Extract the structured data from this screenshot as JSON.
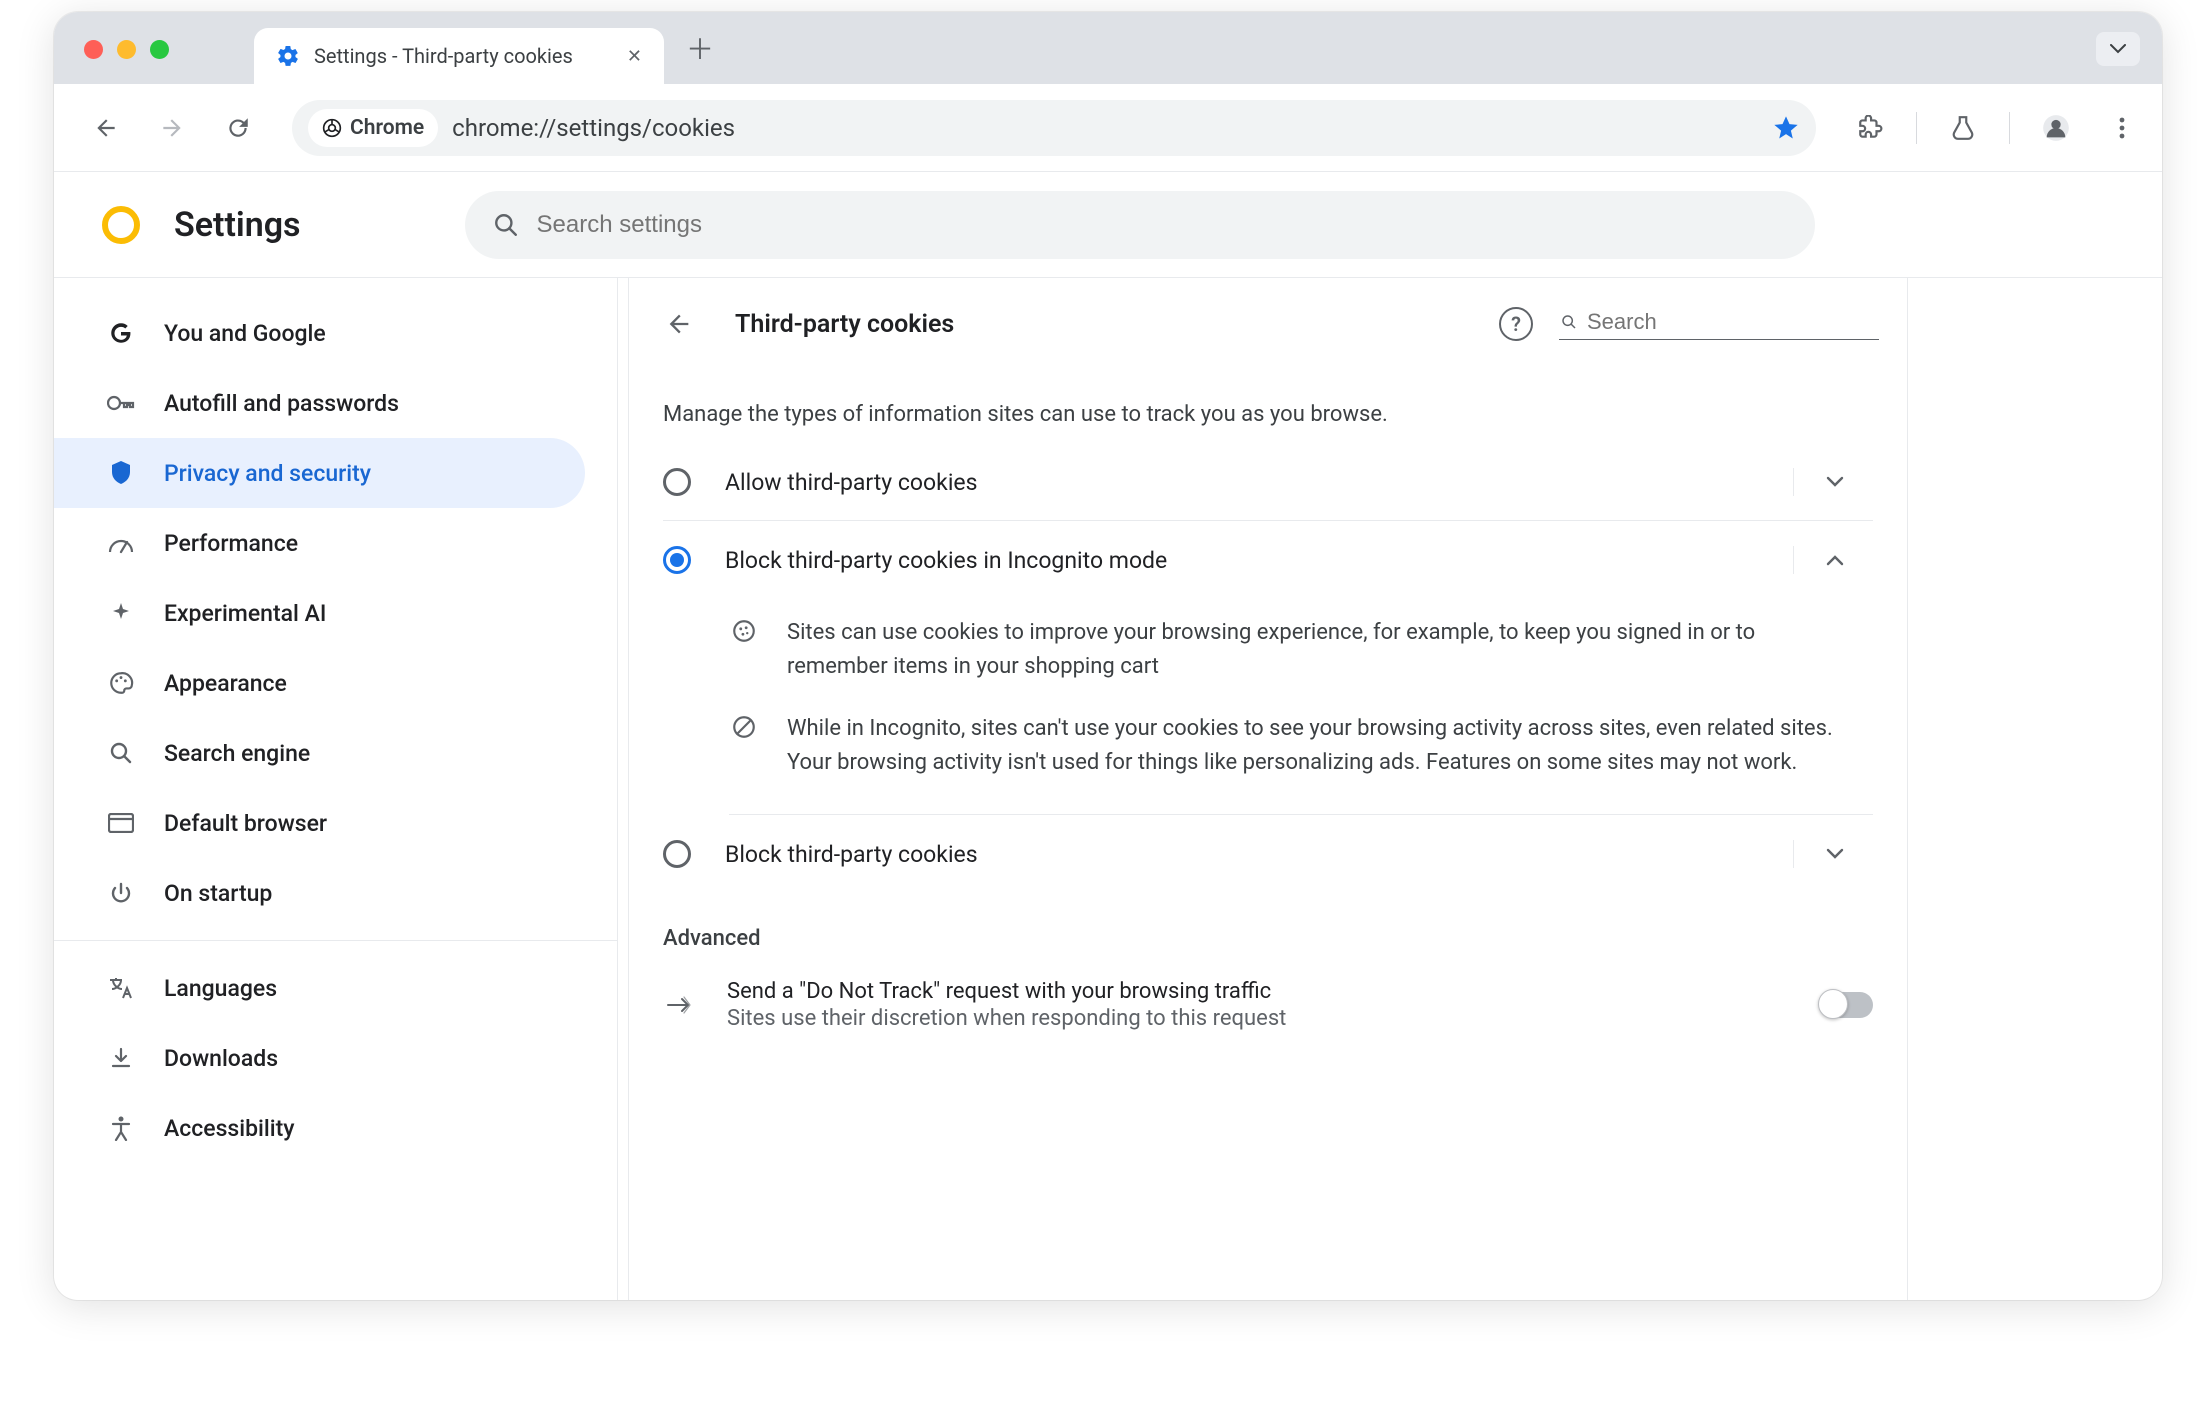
{
  "tab": {
    "title": "Settings - Third-party cookies",
    "favicon": "gear-icon"
  },
  "omnibox": {
    "chip_label": "Chrome",
    "url": "chrome://settings/cookies"
  },
  "header": {
    "app_title": "Settings",
    "search_placeholder": "Search settings"
  },
  "sidebar": {
    "items": [
      {
        "icon": "google-g-icon",
        "label": "You and Google"
      },
      {
        "icon": "key-icon",
        "label": "Autofill and passwords"
      },
      {
        "icon": "shield-icon",
        "label": "Privacy and security",
        "active": true
      },
      {
        "icon": "speedometer-icon",
        "label": "Performance"
      },
      {
        "icon": "sparkle-icon",
        "label": "Experimental AI"
      },
      {
        "icon": "palette-icon",
        "label": "Appearance"
      },
      {
        "icon": "search-icon",
        "label": "Search engine"
      },
      {
        "icon": "window-icon",
        "label": "Default browser"
      },
      {
        "icon": "power-icon",
        "label": "On startup"
      }
    ],
    "items2": [
      {
        "icon": "translate-icon",
        "label": "Languages"
      },
      {
        "icon": "download-icon",
        "label": "Downloads"
      },
      {
        "icon": "accessibility-icon",
        "label": "Accessibility"
      }
    ]
  },
  "content": {
    "page_title": "Third-party cookies",
    "search_placeholder": "Search",
    "manage_text": "Manage the types of information sites can use to track you as you browse.",
    "options": [
      {
        "label": "Allow third-party cookies",
        "checked": false,
        "expanded": false
      },
      {
        "label": "Block third-party cookies in Incognito mode",
        "checked": true,
        "expanded": true
      },
      {
        "label": "Block third-party cookies",
        "checked": false,
        "expanded": false
      }
    ],
    "expanded_details": [
      "Sites can use cookies to improve your browsing experience, for example, to keep you signed in or to remember items in your shopping cart",
      "While in Incognito, sites can't use your cookies to see your browsing activity across sites, even related sites. Your browsing activity isn't used for things like personalizing ads. Features on some sites may not work."
    ],
    "advanced_label": "Advanced",
    "advanced_row": {
      "title": "Send a \"Do Not Track\" request with your browsing traffic",
      "subtitle": "Sites use their discretion when responding to this request",
      "toggled": false
    }
  }
}
